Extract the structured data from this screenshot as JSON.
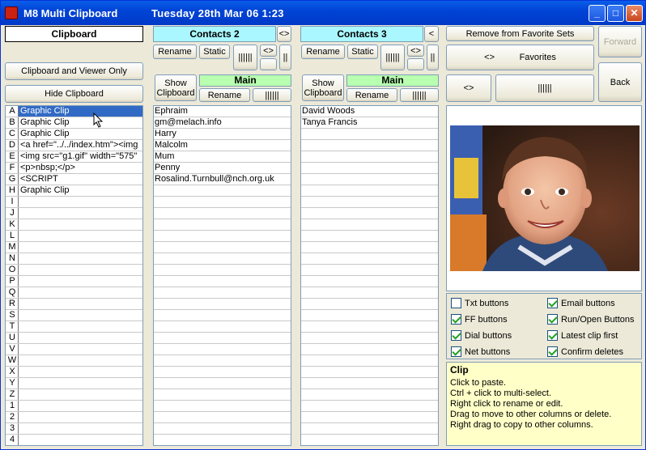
{
  "window": {
    "title": "M8 Multi Clipboard",
    "datetime": "Tuesday  28th Mar 06   1:23"
  },
  "clipboard": {
    "header": "Clipboard",
    "btn_viewer": "Clipboard and Viewer Only",
    "btn_hide": "Hide Clipboard",
    "rows": [
      [
        "A",
        "Graphic Clip"
      ],
      [
        "B",
        "Graphic Clip"
      ],
      [
        "C",
        "Graphic Clip"
      ],
      [
        "D",
        "<a href=\"../../index.htm\"><img"
      ],
      [
        "E",
        "<img src=\"g1.gif\" width=\"575\""
      ],
      [
        "F",
        "<p>nbsp;</p>"
      ],
      [
        "G",
        "<SCRIPT"
      ],
      [
        "H",
        "Graphic Clip"
      ],
      [
        "I",
        ""
      ],
      [
        "J",
        ""
      ],
      [
        "K",
        ""
      ],
      [
        "L",
        ""
      ],
      [
        "M",
        ""
      ],
      [
        "N",
        ""
      ],
      [
        "O",
        ""
      ],
      [
        "P",
        ""
      ],
      [
        "Q",
        ""
      ],
      [
        "R",
        ""
      ],
      [
        "S",
        ""
      ],
      [
        "T",
        ""
      ],
      [
        "U",
        ""
      ],
      [
        "V",
        ""
      ],
      [
        "W",
        ""
      ],
      [
        "X",
        ""
      ],
      [
        "Y",
        ""
      ],
      [
        "Z",
        ""
      ],
      [
        "1",
        ""
      ],
      [
        "2",
        ""
      ],
      [
        "3",
        ""
      ],
      [
        "4",
        ""
      ]
    ]
  },
  "contacts2": {
    "header": "Contacts 2",
    "nav": "<>",
    "rename": "Rename",
    "static": "Static",
    "swap": "<>",
    "show_clipboard": "Show Clipboard",
    "main_header": "Main",
    "main_rename": "Rename",
    "rows": [
      "Ephraim",
      "gm@melach.info",
      "Harry",
      "Malcolm",
      "Mum",
      "Penny",
      "Rosalind.Turnbull@nch.org.uk"
    ]
  },
  "contacts3": {
    "header": "Contacts 3",
    "nav": "<",
    "rename": "Rename",
    "static": "Static",
    "swap": "<>",
    "show_clipboard": "Show Clipboard",
    "main_header": "Main",
    "main_rename": "Rename",
    "rows": [
      "David Woods",
      "Tanya Francis"
    ]
  },
  "right": {
    "remove_fav": "Remove from Favorite Sets",
    "forward": "Forward",
    "favorites": "<>          Favorites",
    "swap": "<>",
    "back": "Back"
  },
  "options": [
    {
      "label": "Txt buttons",
      "checked": false
    },
    {
      "label": "Email buttons",
      "checked": true
    },
    {
      "label": "FF buttons",
      "checked": true
    },
    {
      "label": "Run/Open Buttons",
      "checked": true
    },
    {
      "label": "Dial buttons",
      "checked": true
    },
    {
      "label": "Latest clip first",
      "checked": true
    },
    {
      "label": "Net buttons",
      "checked": true
    },
    {
      "label": "Confirm deletes",
      "checked": true
    }
  ],
  "help": {
    "title": "Clip",
    "lines": [
      "Click to paste.",
      "Ctrl + click to multi-select.",
      "Right click to rename or edit.",
      "Drag to move to other columns or delete.",
      "Right drag to copy to other columns."
    ]
  }
}
